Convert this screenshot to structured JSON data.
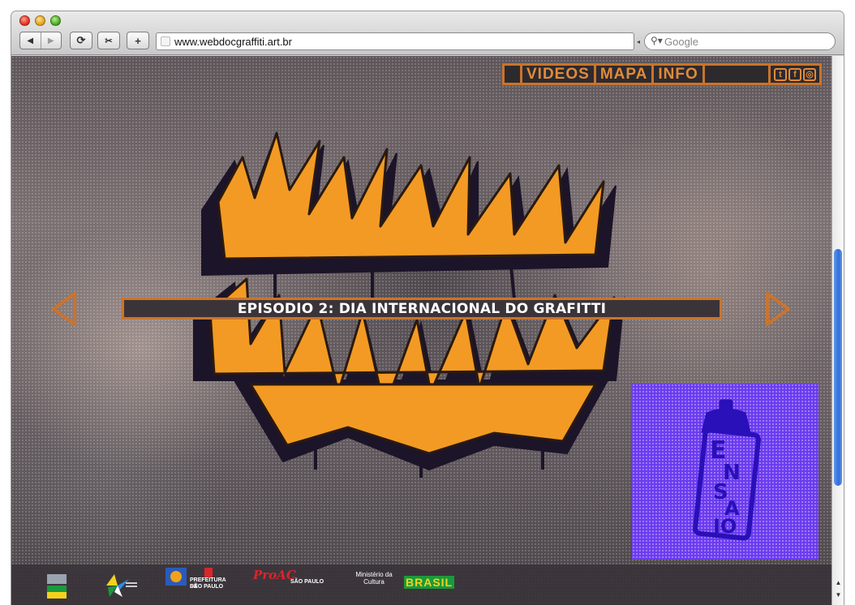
{
  "browser": {
    "url": "www.webdocgraffiti.art.br",
    "search_placeholder": "Google",
    "back_glyph": "◀",
    "forward_glyph": "▶",
    "reload_glyph": "⟳",
    "snippet_glyph": "✂",
    "add_glyph": "+"
  },
  "nav": {
    "items": [
      "VIDEOS",
      "MAPA",
      "INFO"
    ],
    "social_icons": [
      "twitter-icon",
      "facebook-icon",
      "instagram-icon"
    ]
  },
  "episode": {
    "title": "EPISODIO 2: DIA INTERNACIONAL DO GRAFITTI"
  },
  "footer": {
    "proac_label": "ProAC",
    "sp_label": "SÃO PAULO",
    "prefeitura_label": "PREFEITURA DE",
    "prefeitura_city": "SÃO PAULO",
    "ministerio_label": "Ministério da Cultura",
    "brasil_label": "BRASIL"
  },
  "colors": {
    "accent_orange": "#c9742d",
    "nav_text": "#e08b3a",
    "logo_fill": "#f39a24",
    "tile_purple": "#6b3bf0"
  }
}
